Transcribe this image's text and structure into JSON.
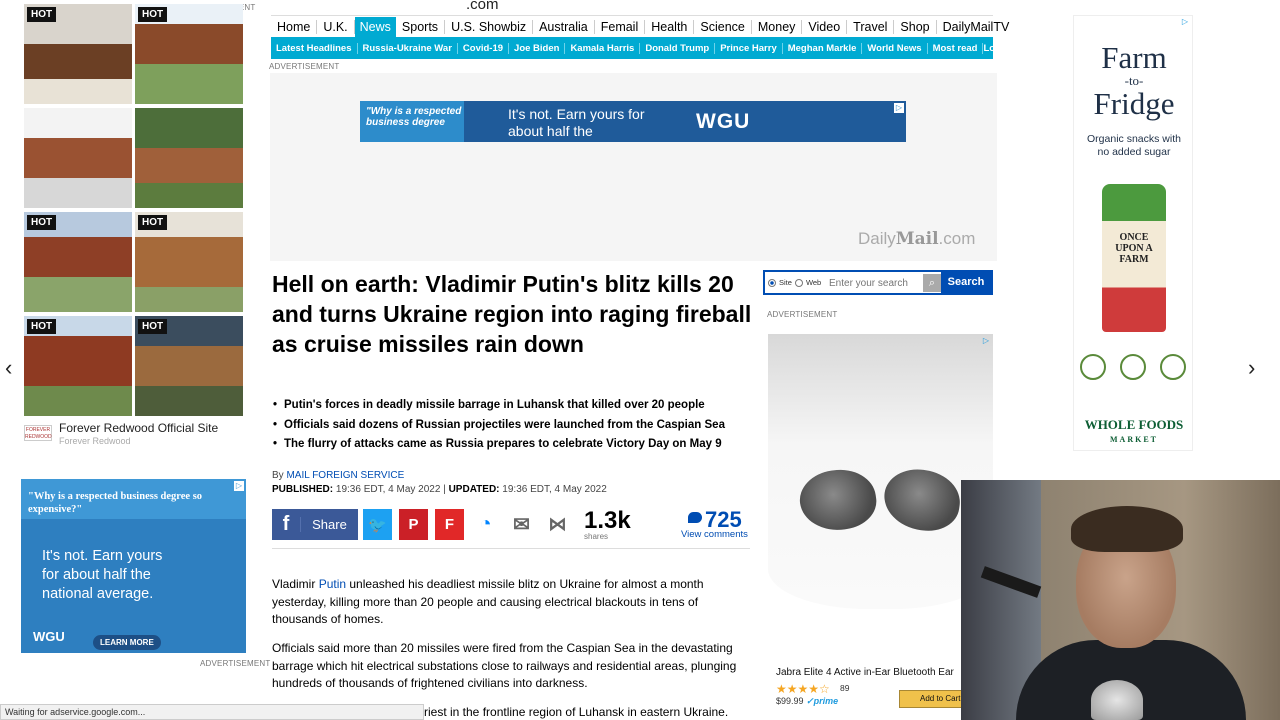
{
  "site": {
    "domain": ".com"
  },
  "nav": {
    "items": [
      "Home",
      "U.K.",
      "News",
      "Sports",
      "U.S. Showbiz",
      "Australia",
      "Femail",
      "Health",
      "Science",
      "Money",
      "Video",
      "Travel",
      "Shop",
      "DailyMailTV"
    ],
    "active": "News"
  },
  "subnav": {
    "items": [
      "Latest Headlines",
      "Russia-Ukraine War",
      "Covid-19",
      "Joe Biden",
      "Kamala Harris",
      "Donald Trump",
      "Prince Harry",
      "Meghan Markle",
      "World News",
      "Most read"
    ],
    "login": "Login"
  },
  "ads": {
    "label": "ADVERTISEMENT",
    "wgu_banner": {
      "quote": "\"Why is a respected business degree",
      "text": "It's not. Earn yours for about half the",
      "logo": "WGU"
    },
    "dailymail_logo": {
      "light": "Daily",
      "bold": "Mail",
      "suffix": ".com"
    },
    "wgu_side": {
      "quote": "\"Why is a respected business degree so expensive?\"",
      "body_lines": [
        "It's not. Earn yours",
        "for about half the",
        "national average."
      ],
      "logo": "WGU",
      "button": "LEARN MORE"
    },
    "redwood": {
      "title": "Forever Redwood Official Site",
      "sub": "Forever Redwood",
      "logo": "FOREVER REDWOOD",
      "hot": "HOT"
    },
    "product": {
      "title": "Jabra Elite 4 Active in-Ear Bluetooth Ear",
      "stars": "★★★★☆",
      "rating": "89",
      "price": "$99.99",
      "prime": "✓prime",
      "cart": "Add to Cart"
    },
    "farm": {
      "line1": "Farm",
      "line2": "-to-",
      "line3": "Fridge",
      "sub": "Organic snacks with no added sugar",
      "brand": "ONCE UPON A FARM",
      "store": "WHOLE FOODS",
      "store_sub": "MARKET"
    }
  },
  "search": {
    "opt_site": "Site",
    "opt_web": "Web",
    "placeholder": "Enter your search",
    "button": "Search"
  },
  "article": {
    "headline": "Hell on earth: Vladimir Putin's blitz kills 20 and turns Ukraine region into raging fireball as cruise missiles rain down",
    "bullets": [
      "Putin's forces in deadly missile barrage in Luhansk that killed over 20 people",
      "Officials said dozens of Russian projectiles were launched from the Caspian Sea",
      "The flurry of attacks came as Russia prepares to celebrate Victory Day on May 9"
    ],
    "by": "By",
    "author": "MAIL FOREIGN SERVICE",
    "published_label": "PUBLISHED:",
    "published": "19:36 EDT, 4 May 2022",
    "updated_label": "UPDATED:",
    "updated": "19:36 EDT, 4 May 2022",
    "share_label": "Share",
    "shares": "1.3k",
    "shares_label": "shares",
    "comments": "725",
    "comments_label": "View comments",
    "p1_pre": "Vladimir ",
    "p1_link": "Putin",
    "p1_post": " unleashed his deadliest missile blitz on Ukraine for almost a month yesterday, killing more than 20 people and causing electrical blackouts in tens of thousands of homes.",
    "p2": "Officials said more than 20 missiles were fired from the Caspian Sea in the devastating barrage which hit electrical substations close to railways and residential areas, plunging hundreds of thousands of frightened civilians into darkness.",
    "p3": "riest in the frontline region of Luhansk in eastern Ukraine."
  },
  "status": {
    "text": "Waiting for adservice.google.com..."
  },
  "colors": {
    "brand": "#00aad2",
    "link": "#004db3",
    "facebook": "#3b5998"
  }
}
